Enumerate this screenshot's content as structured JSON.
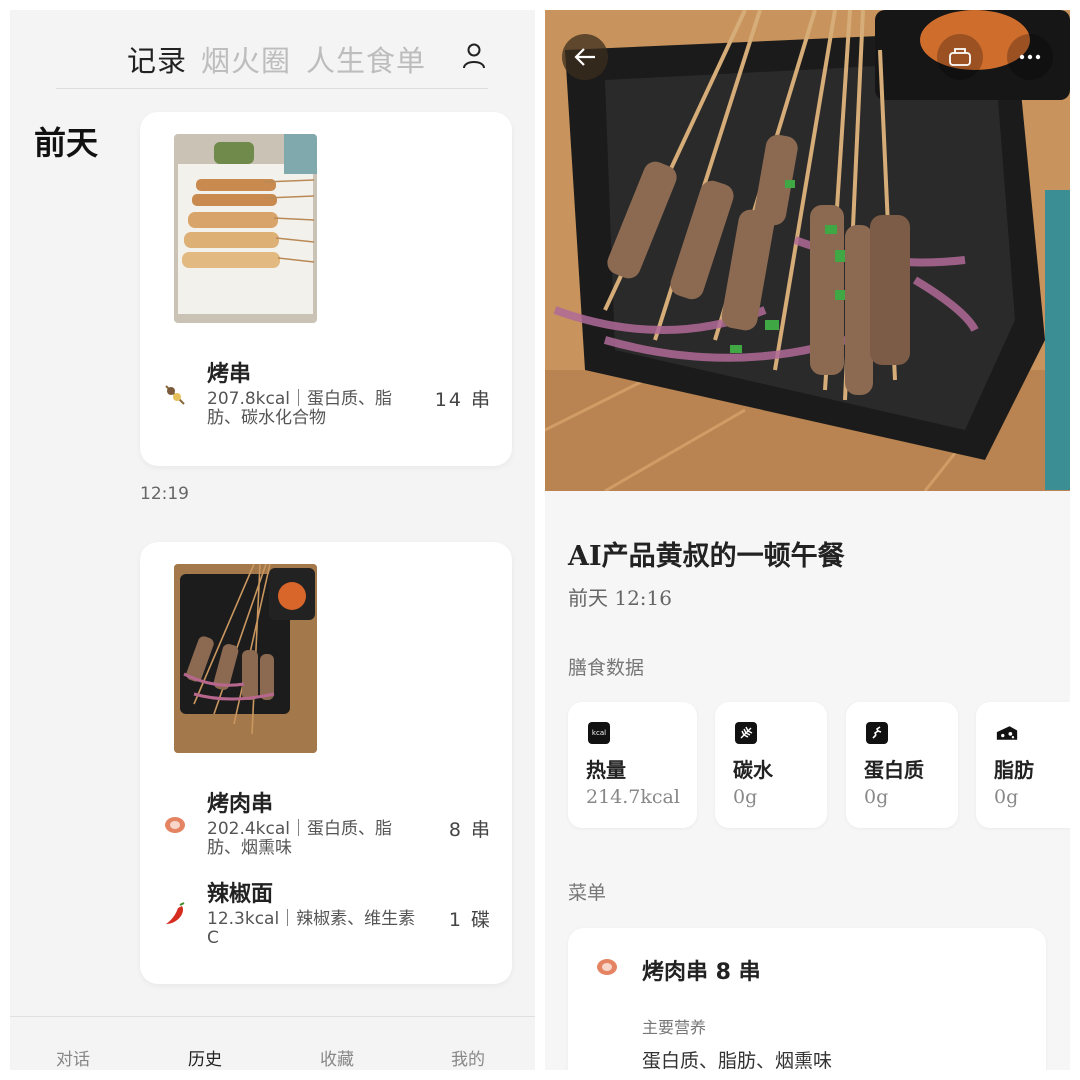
{
  "left": {
    "tabs": {
      "records": "记录",
      "smoke": "烟火圈",
      "menu": "人生食单"
    },
    "day_label": "前天",
    "cards": [
      {
        "items": [
          {
            "icon": "skewer-icon",
            "name": "烤串",
            "desc": "207.8kcal｜蛋白质、脂肪、碳水化合物",
            "qty": "14 串"
          }
        ]
      },
      {
        "items": [
          {
            "icon": "meat-icon",
            "name": "烤肉串",
            "desc": "202.4kcal｜蛋白质、脂肪、烟熏味",
            "qty": "8 串"
          },
          {
            "icon": "chili-icon",
            "name": "辣椒面",
            "desc": "12.3kcal｜辣椒素、维生素C",
            "qty": "1 碟"
          }
        ]
      }
    ],
    "time_label": "12:19",
    "bottom_nav": {
      "chat": "对话",
      "history": "历史",
      "favorites": "收藏",
      "mine": "我的"
    }
  },
  "right": {
    "title": "AI产品黄叔的一顿午餐",
    "time": "前天 12:16",
    "diet_label": "膳食数据",
    "stats": [
      {
        "icon": "kcal-icon",
        "icon_text": "kcal",
        "label": "热量",
        "value": "214.7kcal"
      },
      {
        "icon": "wheat-icon",
        "label": "碳水",
        "value": "0g"
      },
      {
        "icon": "protein-icon",
        "label": "蛋白质",
        "value": "0g"
      },
      {
        "icon": "cheese-icon",
        "label": "脂肪",
        "value": "0g"
      }
    ],
    "menu_label": "菜单",
    "menu_item": {
      "icon": "meat-icon",
      "title": "烤肉串 8 串",
      "nutrients_label": "主要营养",
      "nutrients": "蛋白质、脂肪、烟熏味"
    }
  },
  "colors": {
    "active_tab": "#222222",
    "inactive_tab": "#bdbdbd",
    "background": "#f4f4f4",
    "card": "#ffffff"
  }
}
